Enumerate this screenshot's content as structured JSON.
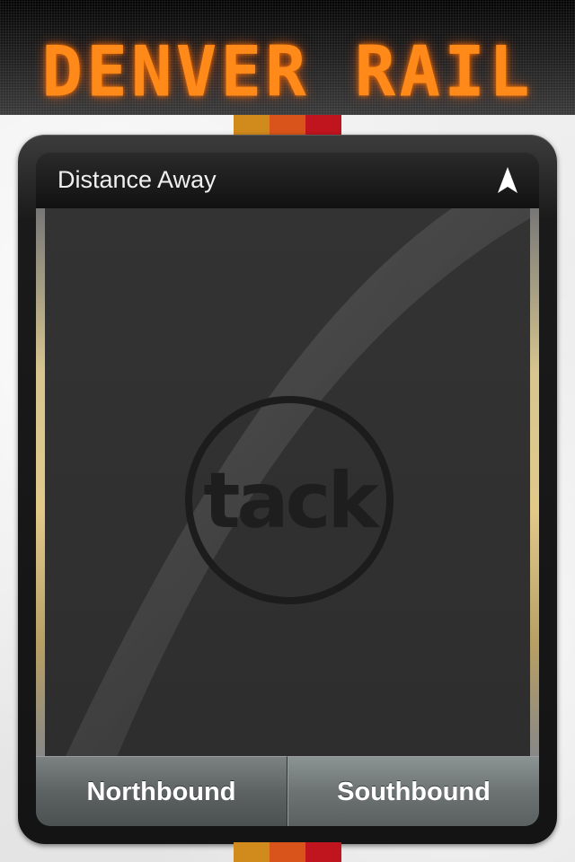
{
  "header": {
    "title": "DENVER RAIL",
    "title_color": "#ff8a1a",
    "stripe_colors": [
      "#d18a1c",
      "#d9541a",
      "#c0141f"
    ]
  },
  "panel": {
    "title": "Distance Away",
    "nav_icon": "location-arrow-icon"
  },
  "logo": {
    "text": "tack",
    "icon": "tack-logo"
  },
  "buttons": {
    "northbound": "Northbound",
    "southbound": "Southbound"
  }
}
